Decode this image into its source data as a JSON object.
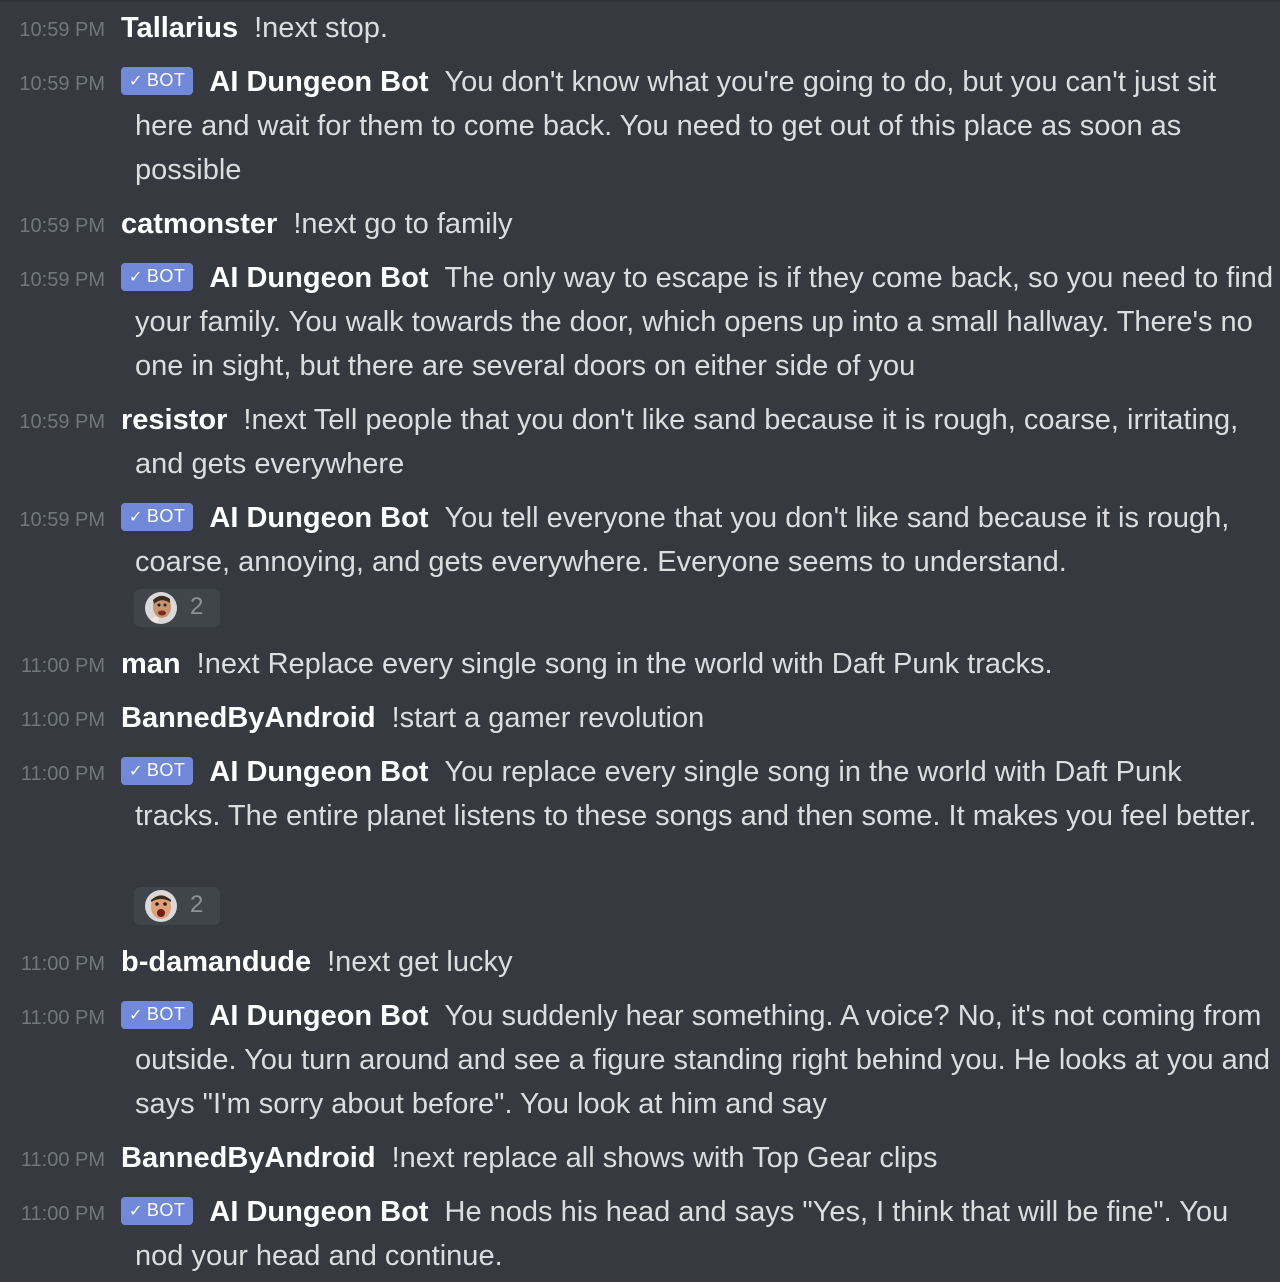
{
  "bot_tag": {
    "check": "✓",
    "label": "BOT"
  },
  "messages": [
    {
      "time": "10:59 PM",
      "author": "Tallarius",
      "text": "!next stop."
    },
    {
      "time": "10:59 PM",
      "author": "AI Dungeon Bot",
      "text": "You don't know what you're going to do, but you can't just sit here and wait for them to come back. You need to get out of this place as soon as possible"
    },
    {
      "time": "10:59 PM",
      "author": "catmonster",
      "text": "!next go to family"
    },
    {
      "time": "10:59 PM",
      "author": "AI Dungeon Bot",
      "text": "The only way to escape is if they come back, so you need to find your family. You walk towards the door, which opens up into a small hallway. There's no one in sight, but there are several doors on either side of you"
    },
    {
      "time": "10:59 PM",
      "author": "resistor",
      "text": "!next Tell people that you don't like sand because it is rough, coarse, irritating, and gets everywhere"
    },
    {
      "time": "10:59 PM",
      "author": "AI Dungeon Bot",
      "text": "You tell everyone that you don't like sand because it is rough, coarse, annoying, and gets everywhere. Everyone seems to understand.",
      "reaction": {
        "emoji": "face-emoji",
        "count": "2"
      }
    },
    {
      "time": "11:00 PM",
      "author": "man",
      "text": "!next Replace every single song in the world with Daft Punk tracks."
    },
    {
      "time": "11:00 PM",
      "author": "BannedByAndroid",
      "text": "!start a gamer revolution"
    },
    {
      "time": "11:00 PM",
      "author": "AI Dungeon Bot",
      "text": "You replace every single song in the world with Daft Punk tracks. The entire planet listens to these songs and then some. It makes you feel better.",
      "reaction": {
        "emoji": "face-emoji",
        "count": "2"
      }
    },
    {
      "time": "11:00 PM",
      "author": "b-damandude",
      "text": "!next get lucky"
    },
    {
      "time": "11:00 PM",
      "author": "AI Dungeon Bot",
      "text": "You suddenly hear something. A voice? No, it's not coming from outside. You turn around and see a figure standing right behind you. He looks at you and says \"I'm sorry about before\". You look at him and say"
    },
    {
      "time": "11:00 PM",
      "author": "BannedByAndroid",
      "text": "!next replace all shows with Top Gear clips"
    },
    {
      "time": "11:00 PM",
      "author": "AI Dungeon Bot",
      "text": "He nods his head and says \"Yes, I think that will be fine\". You nod your head and continue."
    }
  ]
}
